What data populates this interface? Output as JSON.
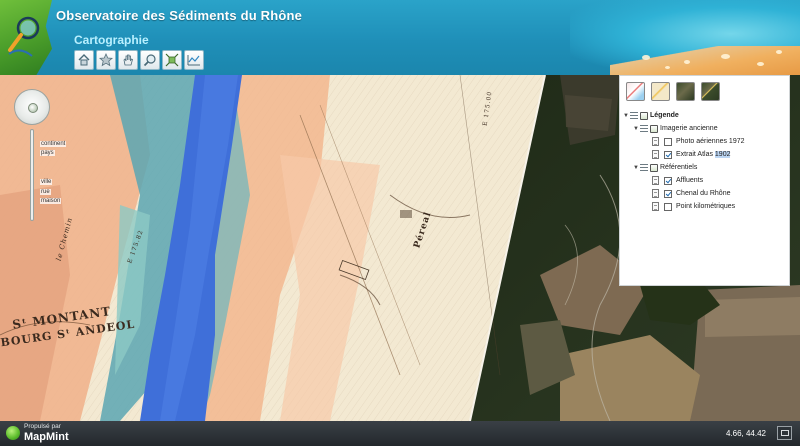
{
  "header": {
    "site_title": "Observatoire des Sédiments du Rhône",
    "page_title": "Cartographie",
    "toolbar": [
      {
        "icon": "home-icon",
        "name": "home-button"
      },
      {
        "icon": "star-icon",
        "name": "favorite-button"
      },
      {
        "icon": "hand-pan-icon",
        "name": "pan-button"
      },
      {
        "icon": "zoom-box-icon",
        "name": "zoom-button"
      },
      {
        "icon": "full-extent-icon",
        "name": "full-extent-button"
      },
      {
        "icon": "profile-chart-icon",
        "name": "profile-button"
      }
    ]
  },
  "map": {
    "zoom_labels": {
      "continent": "continent",
      "pays": "pays",
      "ville": "ville",
      "rue": "rue",
      "maison": "maison"
    },
    "scan_text": {
      "montant": "Sᵗ MONTANT",
      "andeol": "BOURG Sᵗ ANDEOL",
      "pereal": "Péreal",
      "chemin": "le Chemin",
      "north_label": "E 175.00",
      "e_label": "E 175.82"
    }
  },
  "legend": {
    "base_layers": [
      "osm-layer-icon",
      "map-layer-icon",
      "satellite-layer-icon",
      "hybrid-layer-icon"
    ],
    "root_label": "Légende",
    "groups": [
      {
        "label": "Imagerie ancienne",
        "items": [
          {
            "label": "Photo aériennes 1972",
            "checked": false
          },
          {
            "label": "Extrait Atlas ",
            "highlight": "1902",
            "checked": true
          }
        ]
      },
      {
        "label": "Référentiels",
        "items": [
          {
            "label": "Affluents",
            "checked": true
          },
          {
            "label": "Chenal du Rhône",
            "checked": true
          },
          {
            "label": "Point kilométriques",
            "checked": false
          }
        ]
      }
    ]
  },
  "footer": {
    "powered_by": "Propulsé par",
    "brand": "MapMint",
    "coordinates": "4.66, 44.42"
  },
  "colors": {
    "header_blue": "#1f8fb8",
    "page_title": "#b8f0ff",
    "river_blue": "#3f6fd9",
    "check_blue": "#1e6ab0"
  }
}
